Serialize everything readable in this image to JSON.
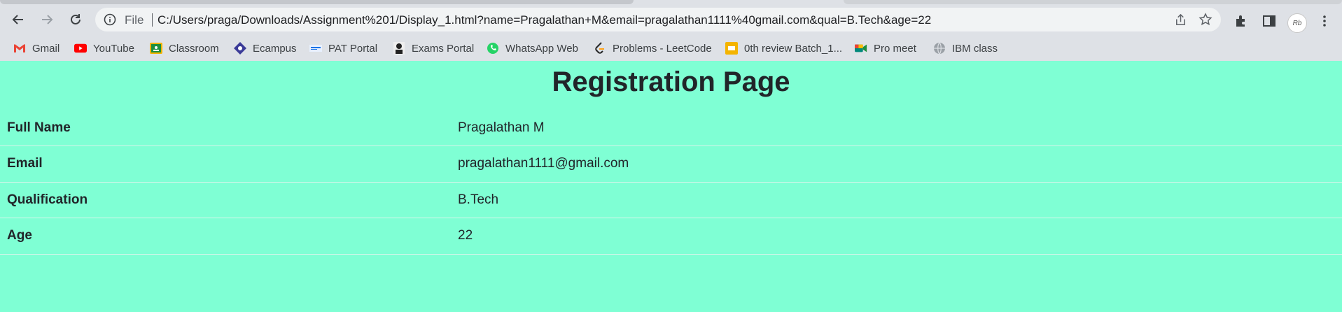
{
  "browser": {
    "address_prefix": "File",
    "url": "C:/Users/praga/Downloads/Assignment%201/Display_1.html?name=Pragalathan+M&email=pragalathan1111%40gmail.com&qual=B.Tech&age=22",
    "profile_initials": "Rb"
  },
  "bookmarks": [
    {
      "label": "Gmail",
      "icon": "gmail-icon",
      "color": "#ea4335"
    },
    {
      "label": "YouTube",
      "icon": "youtube-icon",
      "color": "#ff0000"
    },
    {
      "label": "Classroom",
      "icon": "classroom-icon",
      "color": "#f4b400"
    },
    {
      "label": "Ecampus",
      "icon": "ecampus-icon",
      "color": "#3b3b98"
    },
    {
      "label": "PAT Portal",
      "icon": "pat-portal-icon",
      "color": "#1a73e8"
    },
    {
      "label": "Exams Portal",
      "icon": "exams-portal-icon",
      "color": "#222222"
    },
    {
      "label": "WhatsApp Web",
      "icon": "whatsapp-icon",
      "color": "#25d366"
    },
    {
      "label": "Problems - LeetCode",
      "icon": "leetcode-icon",
      "color": "#ffa116"
    },
    {
      "label": "0th review Batch_1...",
      "icon": "slides-icon",
      "color": "#f4b400"
    },
    {
      "label": "Pro meet",
      "icon": "meet-icon",
      "color": "#00897b"
    },
    {
      "label": "IBM class",
      "icon": "globe-icon",
      "color": "#9aa0a6"
    }
  ],
  "page": {
    "title": "Registration Page",
    "rows": [
      {
        "label": "Full Name",
        "value": "Pragalathan M"
      },
      {
        "label": "Email",
        "value": "pragalathan1111@gmail.com"
      },
      {
        "label": "Qualification",
        "value": "B.Tech"
      },
      {
        "label": "Age",
        "value": "22"
      }
    ],
    "background": "#7fffd4"
  }
}
